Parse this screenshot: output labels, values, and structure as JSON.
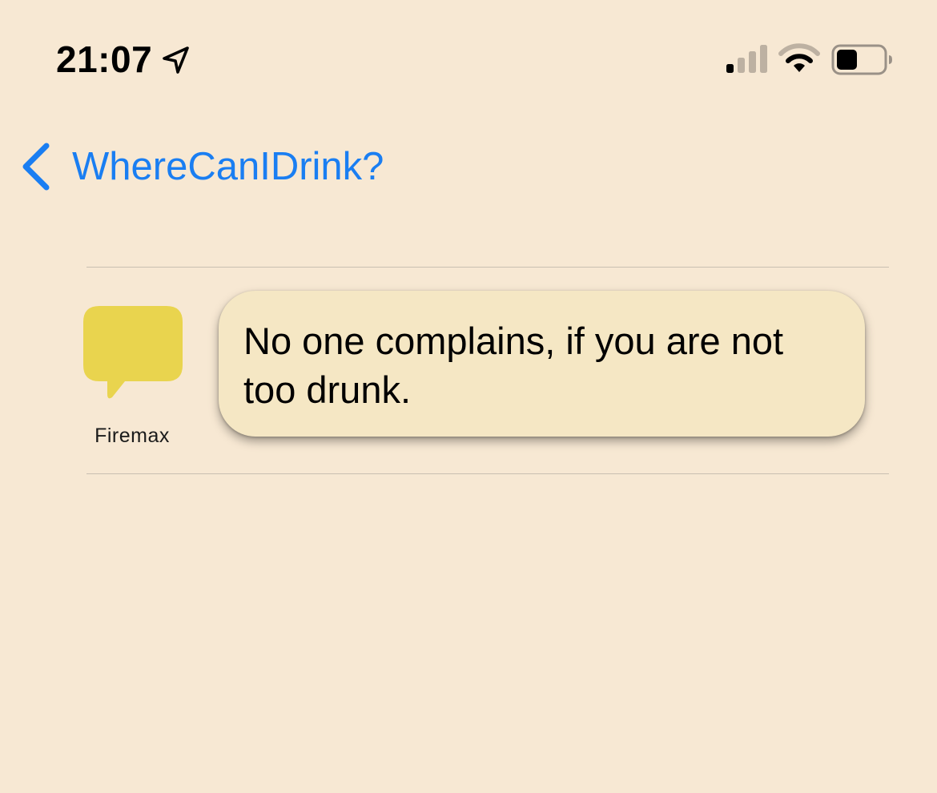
{
  "status_bar": {
    "time": "21:07",
    "location_icon": "location-arrow-icon",
    "signal_icon": "cellular-signal-icon",
    "wifi_icon": "wifi-icon",
    "battery_icon": "battery-icon",
    "signal_bars_active": 1,
    "signal_bars_total": 4,
    "battery_level": 0.45
  },
  "nav": {
    "back_label": "WhereCanIDrink?",
    "back_icon": "chevron-left-icon"
  },
  "comment": {
    "author": "Firemax",
    "avatar_icon": "speech-bubble-icon",
    "text": "No one complains, if you are not too drunk."
  },
  "colors": {
    "background": "#f7e8d3",
    "accent": "#1a7ef2",
    "bubble": "#f5e7c4",
    "avatar": "#e9d44e"
  }
}
